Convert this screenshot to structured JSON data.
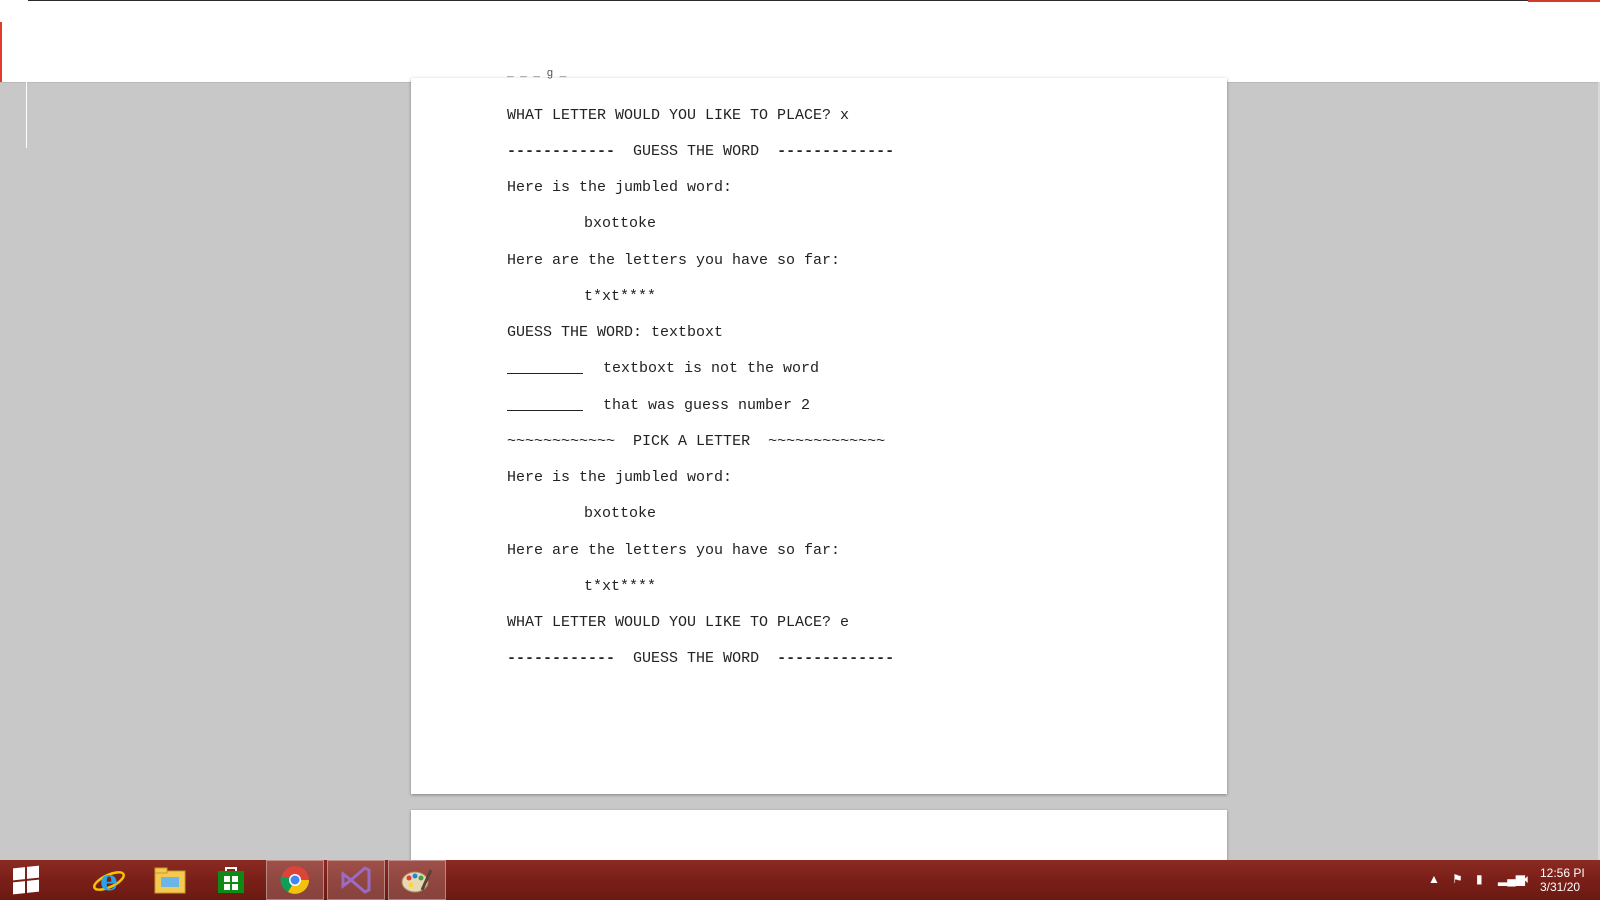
{
  "document": {
    "partial_line": "_ _ _ g _",
    "lines": [
      "WHAT LETTER WOULD YOU LIKE TO PLACE? x",
      "GUESS THE WORD",
      "Here is the jumbled word:",
      "bxottoke",
      "Here are the letters you have so far:",
      "t*xt****",
      "GUESS THE WORD: textboxt",
      "textboxt is not the word",
      "that was guess number 2",
      "PICK A LETTER",
      "Here is the jumbled word:",
      "bxottoke",
      "Here are the letters you have so far:",
      "t*xt****",
      "WHAT LETTER WOULD YOU LIKE TO PLACE? e",
      "GUESS THE WORD"
    ],
    "dash_left": "------------",
    "dash_right": "-------------",
    "tilde_left": "~~~~~~~~~~~~",
    "tilde_right": "~~~~~~~~~~~~~"
  },
  "taskbar": {
    "apps": [
      "start-icon",
      "internet-explorer-icon",
      "file-explorer-icon",
      "store-icon",
      "chrome-icon",
      "visual-studio-icon",
      "paint-icon"
    ],
    "active_app": "chrome-icon",
    "clock_time": "12:56 PI",
    "clock_date": "3/31/20"
  },
  "colors": {
    "taskbar": "#7a1f18",
    "background": "#c8c8c8",
    "page": "#ffffff",
    "vs_purple": "#68217a",
    "store_green": "#107c10"
  }
}
